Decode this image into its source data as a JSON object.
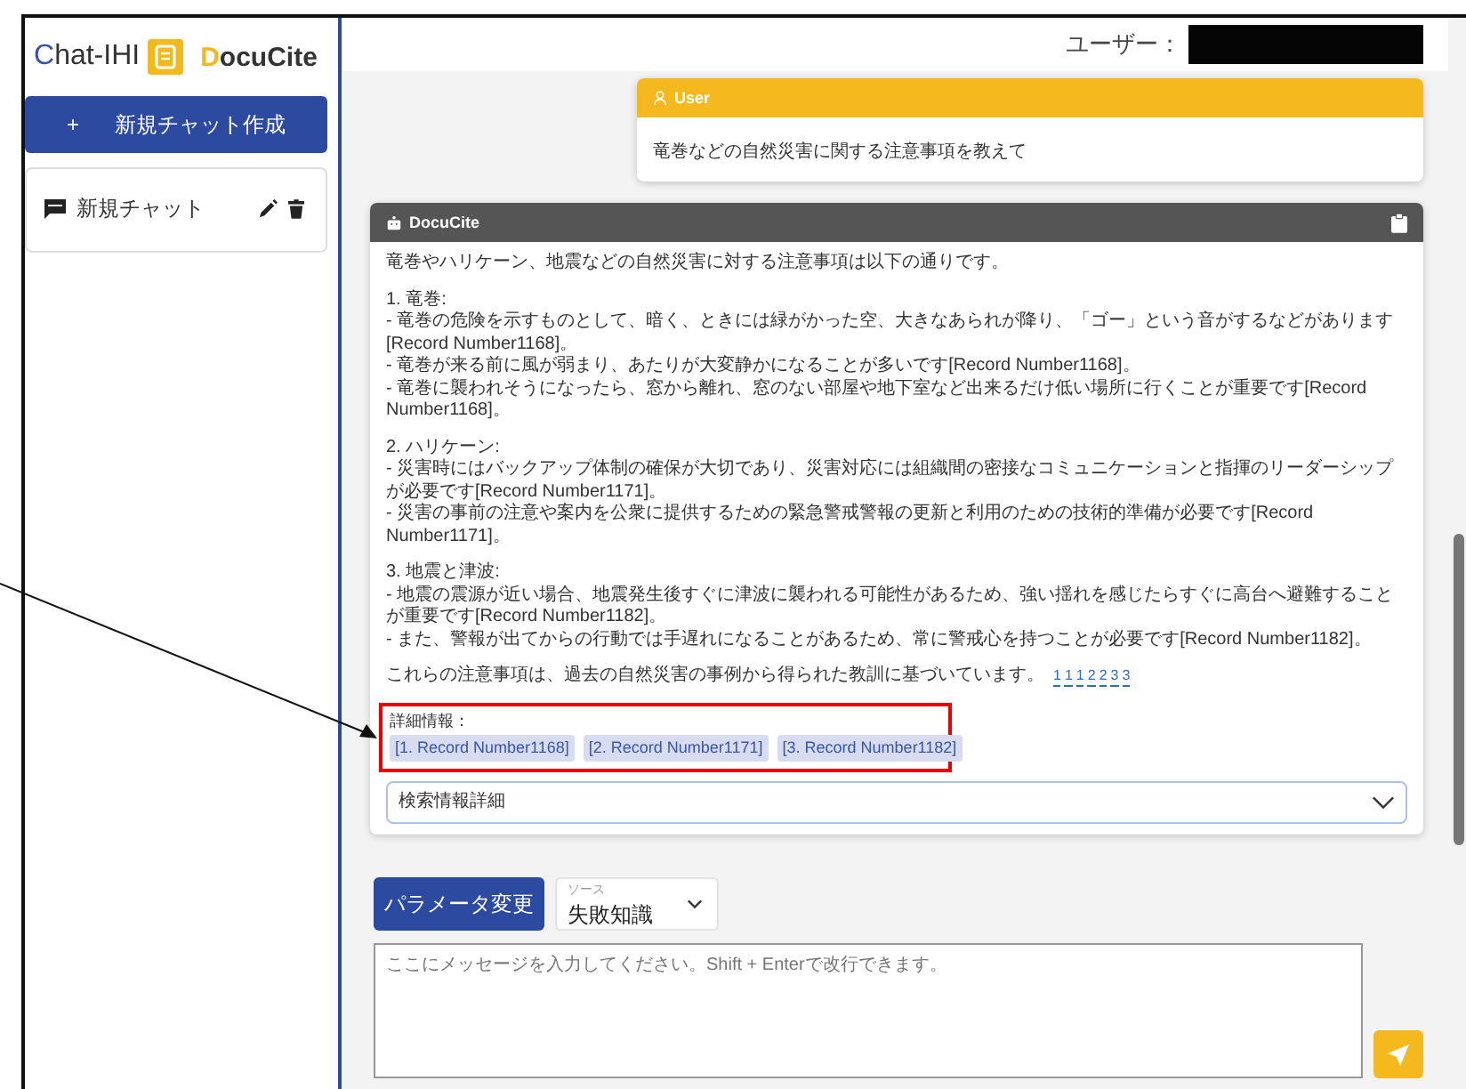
{
  "sidebar": {
    "logo": {
      "chat_text": "Chat-IHI",
      "docucite_text": "DocuCite"
    },
    "new_chat_button": {
      "icon": "+",
      "label": "新規チャット作成"
    },
    "chats": [
      {
        "title": "新規チャット"
      }
    ]
  },
  "header": {
    "user_label": "ユーザー："
  },
  "messages": [
    {
      "kind": "user",
      "author": "User",
      "text": "竜巻などの自然災害に関する注意事項を教えて"
    },
    {
      "kind": "assistant",
      "author": "DocuCite",
      "blocks": [
        [
          "竜巻やハリケーン、地震などの自然災害に対する注意事項は以下の通りです。"
        ],
        [
          "1. 竜巻:",
          "- 竜巻の危険を示すものとして、暗く、ときには緑がかった空、大きなあられが降り、「ゴー」という音がするなどがあります[Record Number1168]。",
          "- 竜巻が来る前に風が弱まり、あたりが大変静かになることが多いです[Record Number1168]。",
          "- 竜巻に襲われそうになったら、窓から離れ、窓のない部屋や地下室など出来るだけ低い場所に行くことが重要です[Record Number1168]。"
        ],
        [
          "2. ハリケーン:",
          "- 災害時にはバックアップ体制の確保が大切であり、災害対応には組織間の密接なコミュニケーションと指揮のリーダーシップが必要です[Record Number1171]。",
          "- 災害の事前の注意や案内を公衆に提供するための緊急警戒警報の更新と利用のための技術的準備が必要です[Record Number1171]。"
        ],
        [
          "3. 地震と津波:",
          "- 地震の震源が近い場合、地震発生後すぐに津波に襲われる可能性があるため、強い揺れを感じたらすぐに高台へ避難することが重要です[Record Number1182]。",
          "- また、警報が出てからの行動では手遅れになることがあるため、常に警戒心を持つことが必要です[Record Number1182]。"
        ]
      ],
      "closing": "これらの注意事項は、過去の自然災害の事例から得られた教訓に基づいています。",
      "citations": [
        "1",
        "1",
        "1",
        "2",
        "2",
        "3",
        "3"
      ],
      "details_label": "詳細情報：",
      "references": [
        "[1. Record Number1168]",
        "[2. Record Number1171]",
        "[3. Record Number1182]"
      ],
      "expander": "検索情報詳細"
    }
  ],
  "composer": {
    "param_button": "パラメータ変更",
    "source": {
      "label": "ソース",
      "value": "失敗知識"
    },
    "input": {
      "placeholder": "ここにメッセージを入力してください。Shift + Enterで改行できます。"
    }
  }
}
